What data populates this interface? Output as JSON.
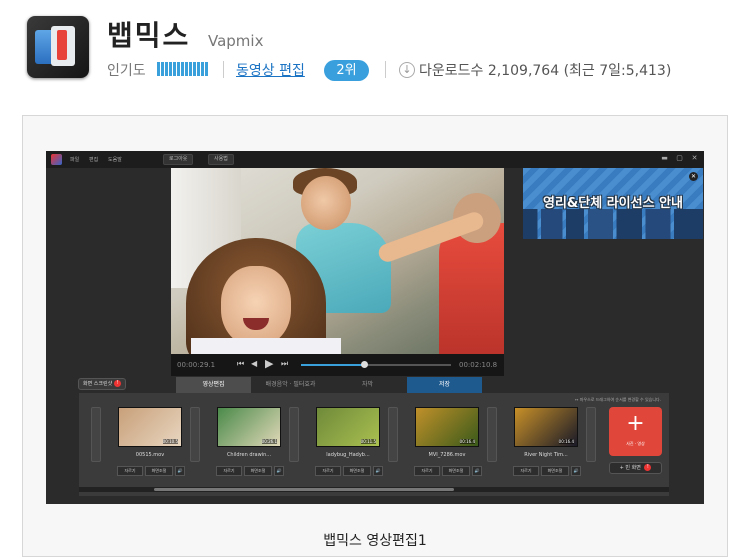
{
  "app": {
    "name": "뱁믹스",
    "name_en": "Vapmix",
    "popularity_label": "인기도",
    "category": "동영상 편집",
    "rank": "2위",
    "download_label": "다운로드수",
    "download_count": "2,109,764",
    "recent": "(최근 7일:5,413)"
  },
  "screenshot": {
    "caption": "뱁믹스 영상편집1",
    "titlebar": {
      "menus": [
        "파일",
        "편집",
        "도움말"
      ],
      "login": "로그아웃",
      "user": "사용법",
      "window_controls": [
        "▬",
        "▢",
        "✕"
      ]
    },
    "player": {
      "time_current": "00:00:29.1",
      "time_total": "00:02:10.8",
      "progress_percent": 42,
      "prev_icon": "⏮",
      "back_icon": "◀",
      "play_icon": "▶",
      "next_icon": "⏭"
    },
    "promo": {
      "text": "영리&단체 라이선스 안내",
      "close": "✕"
    },
    "screenshot_btn": {
      "label": "화면 스크린샷",
      "badge": "!"
    },
    "tabs": [
      {
        "label": "영상편집"
      },
      {
        "label": "배경음악 · 필터효과"
      },
      {
        "label": "자막"
      },
      {
        "label": "저장"
      }
    ],
    "strip_note": "↔ 마우스로 드래그하여 순서를 변경할 수 있습니다.",
    "transition_label": "효과",
    "clips": [
      {
        "name": "00515.mov",
        "dur": "00:10.5",
        "colors": [
          "#c8a07a",
          "#e8d6c0"
        ]
      },
      {
        "name": "Children drawin...",
        "dur": "00:26.1",
        "colors": [
          "#4b8a4a",
          "#e0d8b8"
        ]
      },
      {
        "name": "ladybug_Hadyb...",
        "dur": "00:11.5",
        "colors": [
          "#6f8a3a",
          "#aac050"
        ]
      },
      {
        "name": "MVI_7286.mov",
        "dur": "00:16.4",
        "colors": [
          "#c0902a",
          "#3a5a1a"
        ]
      },
      {
        "name": "River Night Tim...",
        "dur": "00:16.4",
        "colors": [
          "#c89028",
          "#1a1a28"
        ]
      }
    ],
    "clip_buttons": {
      "cut": "자르기",
      "adjust": "화면조절",
      "audio": "🔊"
    },
    "add_button": {
      "plus": "+",
      "label": "사진 · 영상"
    },
    "bg_button": {
      "plus": "+",
      "label": "빈 화면",
      "badge": "!"
    }
  }
}
